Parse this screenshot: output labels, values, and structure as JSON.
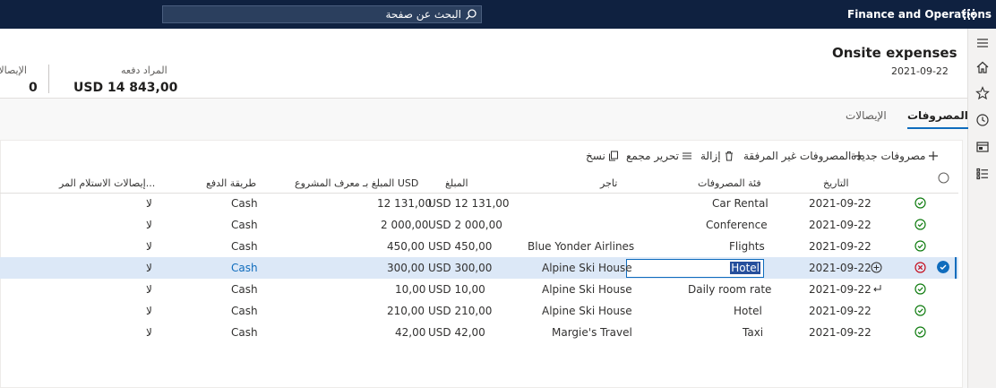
{
  "topbar": {
    "search_placeholder": "البحث عن صفحة",
    "app_name": "Finance and Operations"
  },
  "header": {
    "title": "Onsite expenses",
    "date": "2021-09-22",
    "amount_due_label": "المراد دفعه",
    "amount_due_value": "USD 14 843,00",
    "receipts_label": "الإيصالات",
    "receipts_value": "0"
  },
  "tabs": [
    {
      "label": "المصروفات",
      "active": true
    },
    {
      "label": "الإيصالات",
      "active": false
    }
  ],
  "toolbar": {
    "new_expense": "مصروفات جديدة",
    "unattached_expenses": "المصروفات غير المرفقة",
    "remove": "إزالة",
    "bulk_edit": "تحرير مجمع",
    "copy": "نسخ"
  },
  "columns": {
    "date": "التاريخ",
    "category": "فئة المصروفات",
    "merchant": "تاجر",
    "amount": "المبلغ",
    "amount_in": "المبلغ بـ USD",
    "project_id": "معرف المشروع",
    "payment_method": "طريقة الدفع",
    "receipts_received": "إيصالات الاستلام المر..."
  },
  "rows": [
    {
      "date": "2021-09-22",
      "category": "Car Rental",
      "merchant": "",
      "amount": "USD 12 131,00",
      "amount_usd": "12 131,00",
      "payment": "Cash",
      "receipts": "لا",
      "status": "ok"
    },
    {
      "date": "2021-09-22",
      "category": "Conference",
      "merchant": "",
      "amount": "USD 2 000,00",
      "amount_usd": "2 000,00",
      "payment": "Cash",
      "receipts": "لا",
      "status": "ok"
    },
    {
      "date": "2021-09-22",
      "category": "Flights",
      "merchant": "Blue Yonder Airlines",
      "amount": "USD 450,00",
      "amount_usd": "450,00",
      "payment": "Cash",
      "receipts": "لا",
      "status": "ok"
    },
    {
      "date": "2021-09-22",
      "category": "Hotel",
      "merchant": "Alpine Ski House",
      "amount": "USD 300,00",
      "amount_usd": "300,00",
      "payment": "Cash",
      "receipts": "لا",
      "status": "error"
    },
    {
      "date": "2021-09-22",
      "category": "Daily room rate",
      "merchant": "Alpine Ski House",
      "amount": "USD 10,00",
      "amount_usd": "10,00",
      "payment": "Cash",
      "receipts": "لا",
      "status": "ok"
    },
    {
      "date": "2021-09-22",
      "category": "Hotel",
      "merchant": "Alpine Ski House",
      "amount": "USD 210,00",
      "amount_usd": "210,00",
      "payment": "Cash",
      "receipts": "لا",
      "status": "ok"
    },
    {
      "date": "2021-09-22",
      "category": "Taxi",
      "merchant": "Margie's Travel",
      "amount": "USD 42,00",
      "amount_usd": "42,00",
      "payment": "Cash",
      "receipts": "لا",
      "status": "ok"
    }
  ],
  "colors": {
    "topbar": "#0f2140",
    "accent": "#0f6cbd",
    "ok": "#107c10",
    "error": "#c50f1f",
    "selected_row": "#dce8f7"
  }
}
